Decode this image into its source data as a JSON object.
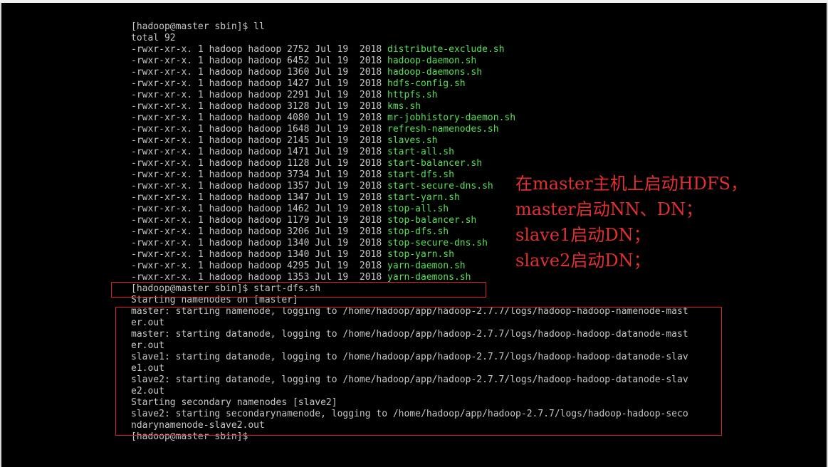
{
  "terminal": {
    "prompt_ll": "[hadoop@master sbin]$ ll",
    "total": "total 92",
    "listing": [
      {
        "perm": "-rwxr-xr-x.",
        "meta": "1 hadoop hadoop 2752 Jul 19  2018",
        "name": "distribute-exclude.sh"
      },
      {
        "perm": "-rwxr-xr-x.",
        "meta": "1 hadoop hadoop 6452 Jul 19  2018",
        "name": "hadoop-daemon.sh"
      },
      {
        "perm": "-rwxr-xr-x.",
        "meta": "1 hadoop hadoop 1360 Jul 19  2018",
        "name": "hadoop-daemons.sh"
      },
      {
        "perm": "-rwxr-xr-x.",
        "meta": "1 hadoop hadoop 1427 Jul 19  2018",
        "name": "hdfs-config.sh"
      },
      {
        "perm": "-rwxr-xr-x.",
        "meta": "1 hadoop hadoop 2291 Jul 19  2018",
        "name": "httpfs.sh"
      },
      {
        "perm": "-rwxr-xr-x.",
        "meta": "1 hadoop hadoop 3128 Jul 19  2018",
        "name": "kms.sh"
      },
      {
        "perm": "-rwxr-xr-x.",
        "meta": "1 hadoop hadoop 4080 Jul 19  2018",
        "name": "mr-jobhistory-daemon.sh"
      },
      {
        "perm": "-rwxr-xr-x.",
        "meta": "1 hadoop hadoop 1648 Jul 19  2018",
        "name": "refresh-namenodes.sh"
      },
      {
        "perm": "-rwxr-xr-x.",
        "meta": "1 hadoop hadoop 2145 Jul 19  2018",
        "name": "slaves.sh"
      },
      {
        "perm": "-rwxr-xr-x.",
        "meta": "1 hadoop hadoop 1471 Jul 19  2018",
        "name": "start-all.sh"
      },
      {
        "perm": "-rwxr-xr-x.",
        "meta": "1 hadoop hadoop 1128 Jul 19  2018",
        "name": "start-balancer.sh"
      },
      {
        "perm": "-rwxr-xr-x.",
        "meta": "1 hadoop hadoop 3734 Jul 19  2018",
        "name": "start-dfs.sh"
      },
      {
        "perm": "-rwxr-xr-x.",
        "meta": "1 hadoop hadoop 1357 Jul 19  2018",
        "name": "start-secure-dns.sh"
      },
      {
        "perm": "-rwxr-xr-x.",
        "meta": "1 hadoop hadoop 1347 Jul 19  2018",
        "name": "start-yarn.sh"
      },
      {
        "perm": "-rwxr-xr-x.",
        "meta": "1 hadoop hadoop 1462 Jul 19  2018",
        "name": "stop-all.sh"
      },
      {
        "perm": "-rwxr-xr-x.",
        "meta": "1 hadoop hadoop 1179 Jul 19  2018",
        "name": "stop-balancer.sh"
      },
      {
        "perm": "-rwxr-xr-x.",
        "meta": "1 hadoop hadoop 3206 Jul 19  2018",
        "name": "stop-dfs.sh"
      },
      {
        "perm": "-rwxr-xr-x.",
        "meta": "1 hadoop hadoop 1340 Jul 19  2018",
        "name": "stop-secure-dns.sh"
      },
      {
        "perm": "-rwxr-xr-x.",
        "meta": "1 hadoop hadoop 1340 Jul 19  2018",
        "name": "stop-yarn.sh"
      },
      {
        "perm": "-rwxr-xr-x.",
        "meta": "1 hadoop hadoop 4295 Jul 19  2018",
        "name": "yarn-daemon.sh"
      },
      {
        "perm": "-rwxr-xr-x.",
        "meta": "1 hadoop hadoop 1353 Jul 19  2018",
        "name": "yarn-daemons.sh"
      }
    ],
    "prompt_start": "[hadoop@master sbin]$ start-dfs.sh",
    "output": [
      "Starting namenodes on [master]",
      "master: starting namenode, logging to /home/hadoop/app/hadoop-2.7.7/logs/hadoop-hadoop-namenode-mast",
      "er.out",
      "master: starting datanode, logging to /home/hadoop/app/hadoop-2.7.7/logs/hadoop-hadoop-datanode-mast",
      "er.out",
      "slave1: starting datanode, logging to /home/hadoop/app/hadoop-2.7.7/logs/hadoop-hadoop-datanode-slav",
      "e1.out",
      "slave2: starting datanode, logging to /home/hadoop/app/hadoop-2.7.7/logs/hadoop-hadoop-datanode-slav",
      "e2.out",
      "Starting secondary namenodes [slave2]",
      "slave2: starting secondarynamenode, logging to /home/hadoop/app/hadoop-2.7.7/logs/hadoop-hadoop-seco",
      "ndarynamenode-slave2.out"
    ],
    "prompt_end": "[hadoop@master sbin]$"
  },
  "annotation": {
    "lines": [
      "在master主机上启动HDFS，",
      "master启动NN、DN；",
      "slave1启动DN；",
      "slave2启动DN；"
    ]
  },
  "colors": {
    "background": "#000000",
    "text": "#c7c7c7",
    "filename": "#55e055",
    "annotation": "#e03030"
  }
}
